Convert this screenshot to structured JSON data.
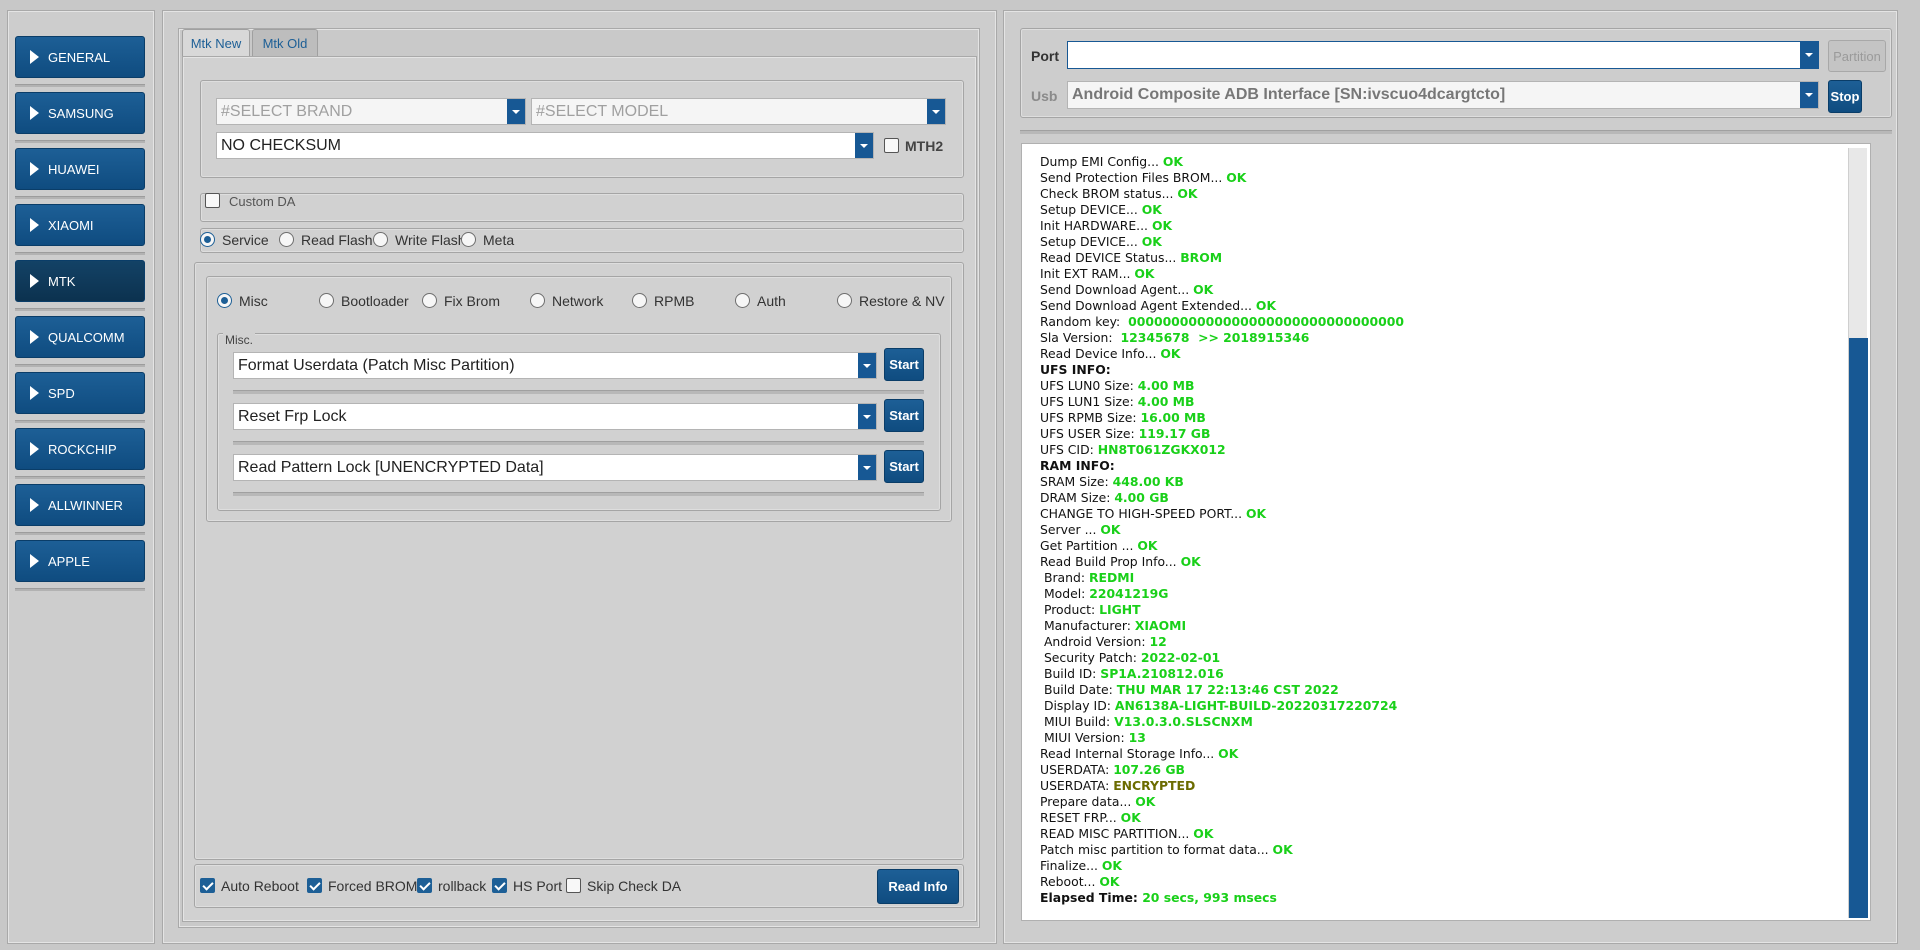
{
  "sidebar": {
    "items": [
      {
        "label": "GENERAL"
      },
      {
        "label": "SAMSUNG"
      },
      {
        "label": "HUAWEI"
      },
      {
        "label": "XIAOMI"
      },
      {
        "label": "MTK"
      },
      {
        "label": "QUALCOMM"
      },
      {
        "label": "SPD"
      },
      {
        "label": "ROCKCHIP"
      },
      {
        "label": "ALLWINNER"
      },
      {
        "label": "APPLE"
      }
    ],
    "active": "MTK"
  },
  "tabs": [
    {
      "label": "Mtk New"
    },
    {
      "label": "Mtk Old"
    }
  ],
  "selectors": {
    "brand_placeholder": "#SELECT BRAND",
    "model_placeholder": "#SELECT MODEL",
    "checksum_value": "NO CHECKSUM",
    "mth2_label": "MTH2",
    "custom_da_label": "Custom DA"
  },
  "modes": [
    {
      "label": "Service",
      "selected": true
    },
    {
      "label": "Read Flash",
      "selected": false
    },
    {
      "label": "Write Flash",
      "selected": false
    },
    {
      "label": "Meta",
      "selected": false
    }
  ],
  "subtabs": [
    {
      "label": "Misc",
      "selected": true
    },
    {
      "label": "Bootloader",
      "selected": false
    },
    {
      "label": "Fix Brom",
      "selected": false
    },
    {
      "label": "Network",
      "selected": false
    },
    {
      "label": "RPMB",
      "selected": false
    },
    {
      "label": "Auth",
      "selected": false
    },
    {
      "label": "Restore & NV",
      "selected": false
    }
  ],
  "misc": {
    "group_title": "Misc.",
    "rows": [
      {
        "value": "Format Userdata (Patch Misc Partition)",
        "button": "Start"
      },
      {
        "value": "Reset Frp Lock",
        "button": "Start"
      },
      {
        "value": "Read Pattern Lock [UNENCRYPTED Data]",
        "button": "Start"
      }
    ]
  },
  "options": [
    {
      "label": "Auto Reboot",
      "checked": true
    },
    {
      "label": "Forced BROM",
      "checked": true
    },
    {
      "label": "rollback",
      "checked": true
    },
    {
      "label": "HS Port",
      "checked": true
    },
    {
      "label": "Skip Check DA",
      "checked": false
    }
  ],
  "read_info_label": "Read Info",
  "port": {
    "port_label": "Port",
    "port_value": "",
    "partition_label": "Partition",
    "usb_label": "Usb",
    "usb_value": "Android Composite ADB Interface [SN:ivscuo4dcargtcto]",
    "stop_label": "Stop"
  },
  "log": [
    [
      {
        "t": "Dump EMI Config... "
      },
      {
        "t": "OK",
        "c": "ok"
      }
    ],
    [
      {
        "t": "Send Protection Files BROM... "
      },
      {
        "t": "OK",
        "c": "ok"
      }
    ],
    [
      {
        "t": "Check BROM status... "
      },
      {
        "t": "OK",
        "c": "ok"
      }
    ],
    [
      {
        "t": "Setup DEVICE... "
      },
      {
        "t": "OK",
        "c": "ok"
      }
    ],
    [
      {
        "t": "Init HARDWARE... "
      },
      {
        "t": "OK",
        "c": "ok"
      }
    ],
    [
      {
        "t": "Setup DEVICE... "
      },
      {
        "t": "OK",
        "c": "ok"
      }
    ],
    [
      {
        "t": "Read DEVICE Status... "
      },
      {
        "t": "BROM",
        "c": "st"
      }
    ],
    [
      {
        "t": "Init EXT RAM... "
      },
      {
        "t": "OK",
        "c": "ok"
      }
    ],
    [
      {
        "t": "Send Download Agent... "
      },
      {
        "t": "OK",
        "c": "ok"
      }
    ],
    [
      {
        "t": "Send Download Agent Extended... "
      },
      {
        "t": "OK",
        "c": "ok"
      }
    ],
    [
      {
        "t": "Random key:  "
      },
      {
        "t": "00000000000000000000000000000000",
        "c": "st"
      }
    ],
    [
      {
        "t": "Sla Version:  "
      },
      {
        "t": "12345678  >> 2018915346",
        "c": "st"
      }
    ],
    [
      {
        "t": "Read Device Info... "
      },
      {
        "t": "OK",
        "c": "ok"
      }
    ],
    [
      {
        "t": "UFS INFO:",
        "c": "hdr"
      }
    ],
    [
      {
        "t": "UFS LUN0 Size: "
      },
      {
        "t": "4.00 MB",
        "c": "st"
      }
    ],
    [
      {
        "t": "UFS LUN1 Size: "
      },
      {
        "t": "4.00 MB",
        "c": "st"
      }
    ],
    [
      {
        "t": "UFS RPMB Size: "
      },
      {
        "t": "16.00 MB",
        "c": "st"
      }
    ],
    [
      {
        "t": "UFS USER Size: "
      },
      {
        "t": "119.17 GB",
        "c": "st"
      }
    ],
    [
      {
        "t": "UFS CID: "
      },
      {
        "t": "HN8T061ZGKX012",
        "c": "st"
      }
    ],
    [
      {
        "t": "RAM INFO:",
        "c": "hdr"
      }
    ],
    [
      {
        "t": "SRAM Size: "
      },
      {
        "t": "448.00 KB",
        "c": "st"
      }
    ],
    [
      {
        "t": "DRAM Size: "
      },
      {
        "t": "4.00 GB",
        "c": "st"
      }
    ],
    [
      {
        "t": "CHANGE TO HIGH-SPEED PORT... "
      },
      {
        "t": "OK",
        "c": "ok"
      }
    ],
    [
      {
        "t": "Server ... "
      },
      {
        "t": "OK",
        "c": "ok"
      }
    ],
    [
      {
        "t": "Get Partition ... "
      },
      {
        "t": "OK",
        "c": "ok"
      }
    ],
    [
      {
        "t": "Read Build Prop Info... "
      },
      {
        "t": "OK",
        "c": "ok"
      }
    ],
    [
      {
        "t": " Brand: "
      },
      {
        "t": "REDMI",
        "c": "st"
      }
    ],
    [
      {
        "t": " Model: "
      },
      {
        "t": "22041219G",
        "c": "st"
      }
    ],
    [
      {
        "t": " Product: "
      },
      {
        "t": "LIGHT",
        "c": "st"
      }
    ],
    [
      {
        "t": " Manufacturer: "
      },
      {
        "t": "XIAOMI",
        "c": "st"
      }
    ],
    [
      {
        "t": " Android Version: "
      },
      {
        "t": "12",
        "c": "st"
      }
    ],
    [
      {
        "t": " Security Patch: "
      },
      {
        "t": "2022-02-01",
        "c": "st"
      }
    ],
    [
      {
        "t": " Build ID: "
      },
      {
        "t": "SP1A.210812.016",
        "c": "st"
      }
    ],
    [
      {
        "t": " Build Date: "
      },
      {
        "t": "THU MAR 17 22:13:46 CST 2022",
        "c": "st"
      }
    ],
    [
      {
        "t": " Display ID: "
      },
      {
        "t": "AN6138A-LIGHT-BUILD-20220317220724",
        "c": "st"
      }
    ],
    [
      {
        "t": " MIUI Build: "
      },
      {
        "t": "V13.0.3.0.SLSCNXM",
        "c": "st"
      }
    ],
    [
      {
        "t": " MIUI Version: "
      },
      {
        "t": "13",
        "c": "st"
      }
    ],
    [
      {
        "t": "Read Internal Storage Info... "
      },
      {
        "t": "OK",
        "c": "ok"
      }
    ],
    [
      {
        "t": "USERDATA: "
      },
      {
        "t": "107.26 GB",
        "c": "st"
      }
    ],
    [
      {
        "t": "USERDATA: "
      },
      {
        "t": "ENCRYPTED",
        "c": "warn"
      }
    ],
    [
      {
        "t": "Prepare data... "
      },
      {
        "t": "OK",
        "c": "ok"
      }
    ],
    [
      {
        "t": "RESET FRP... "
      },
      {
        "t": "OK",
        "c": "ok"
      }
    ],
    [
      {
        "t": "READ MISC PARTITION... "
      },
      {
        "t": "OK",
        "c": "ok"
      }
    ],
    [
      {
        "t": "Patch misc partition to format data... "
      },
      {
        "t": "OK",
        "c": "ok"
      }
    ],
    [
      {
        "t": "Finalize... "
      },
      {
        "t": "OK",
        "c": "ok"
      }
    ],
    [
      {
        "t": "Reboot... "
      },
      {
        "t": "OK",
        "c": "ok"
      }
    ],
    [
      {
        "t": "Elapsed Time: ",
        "c": "hdr"
      },
      {
        "t": "20 secs, 993 msecs",
        "c": "st"
      }
    ]
  ],
  "colors": {
    "accent": "#175894",
    "ok": "#19d019",
    "warn": "#6b6b00",
    "background": "#c8c8c8"
  }
}
